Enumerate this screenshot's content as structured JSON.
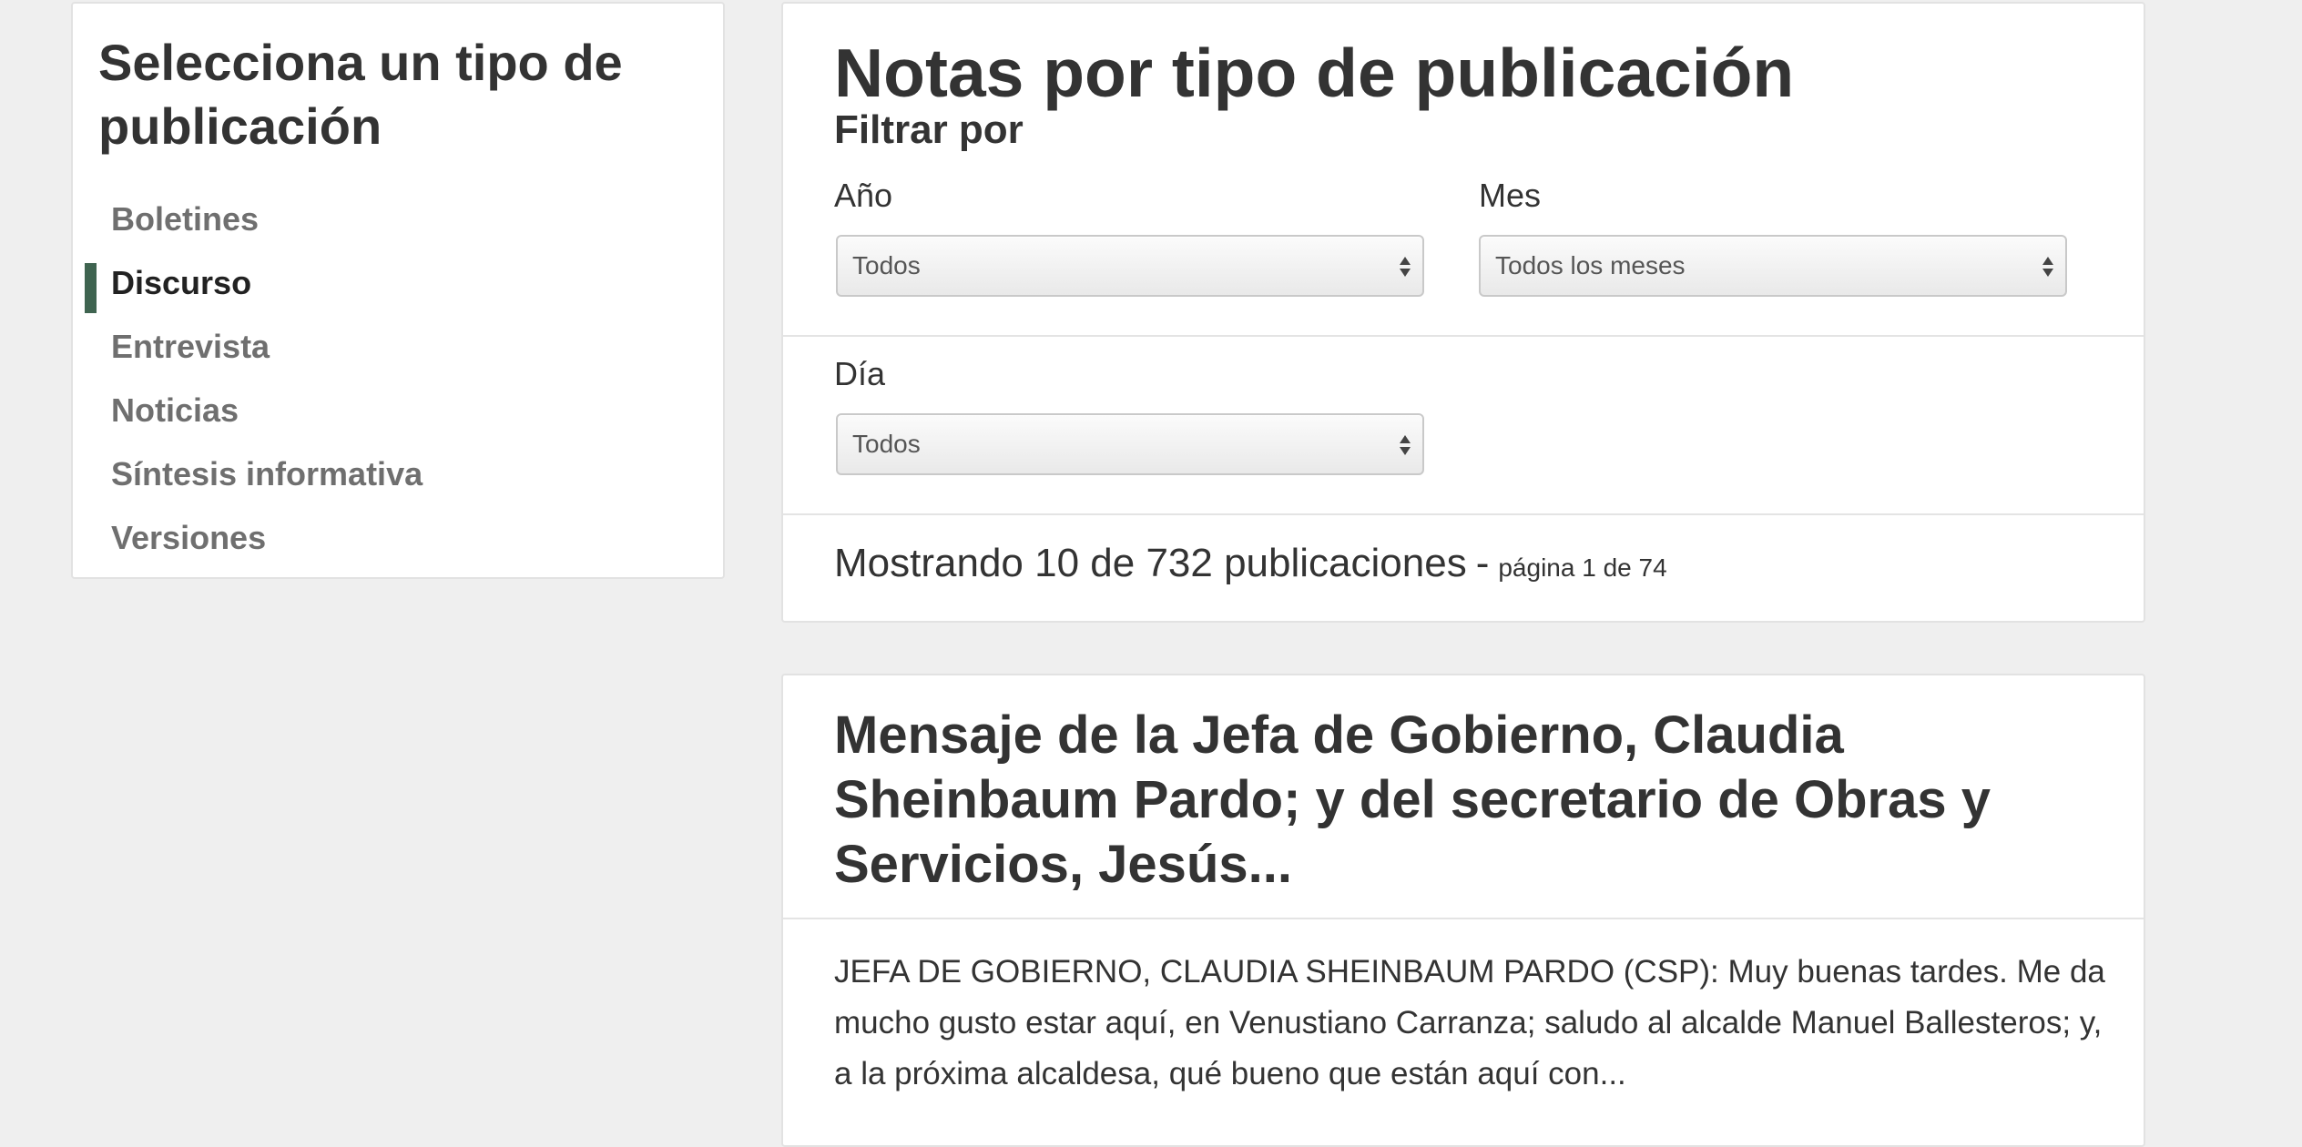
{
  "sidebar": {
    "title": "Selecciona un tipo de publicación",
    "items": [
      {
        "label": "Boletines",
        "active": false
      },
      {
        "label": "Discurso",
        "active": true
      },
      {
        "label": "Entrevista",
        "active": false
      },
      {
        "label": "Noticias",
        "active": false
      },
      {
        "label": "Síntesis informativa",
        "active": false
      },
      {
        "label": "Versiones",
        "active": false
      }
    ],
    "accent_color": "#3f6450"
  },
  "filters": {
    "title": "Notas por tipo de publicación",
    "heading": "Filtrar por",
    "year": {
      "label": "Año",
      "value": "Todos"
    },
    "month": {
      "label": "Mes",
      "value": "Todos los meses"
    },
    "day": {
      "label": "Día",
      "value": "Todos"
    },
    "arrow_icon": "up-down-arrows-icon"
  },
  "results": {
    "summary": "Mostrando 10 de 732 publicaciones",
    "separator": "-",
    "page": "página 1 de 74"
  },
  "article": {
    "title": "Mensaje de la Jefa de Gobierno, Claudia Sheinbaum Pardo; y del secretario de Obras y Servicios, Jesús...",
    "excerpt": "JEFA DE GOBIERNO, CLAUDIA SHEINBAUM PARDO (CSP): Muy buenas tardes. Me da mucho gusto estar aquí, en Venustiano Carranza; saludo al alcalde Manuel Ballesteros; y, a la próxima alcaldesa, qué bueno que están aquí con..."
  }
}
